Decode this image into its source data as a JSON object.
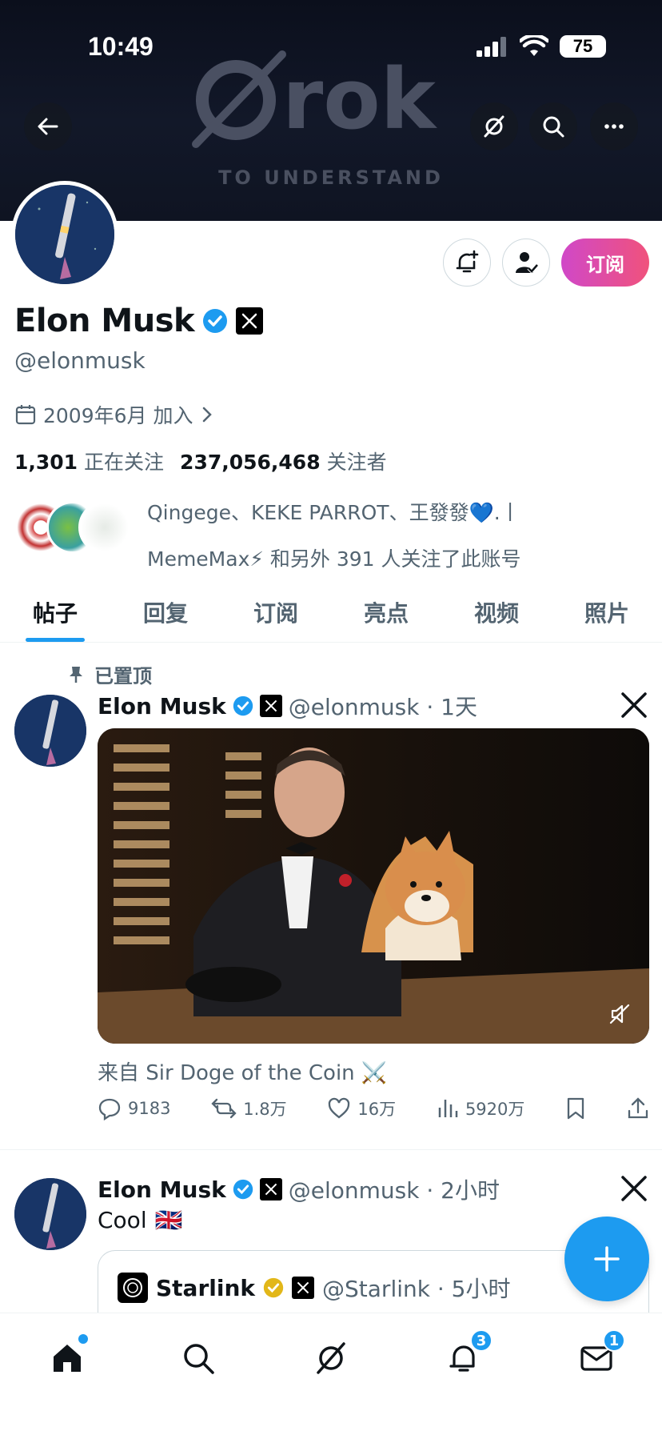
{
  "status_bar": {
    "time": "10:49",
    "battery": "75"
  },
  "banner": {
    "logo_text": "Grok",
    "tagline": "TO UNDERSTAND"
  },
  "profile": {
    "name": "Elon Musk",
    "handle": "@elonmusk",
    "joined": "2009年6月 加入",
    "following_count": "1,301",
    "following_label": "正在关注",
    "followers_count": "237,056,468",
    "followers_label": "关注者",
    "followed_by_line1": "Qingege、KEKE PARROT、王發發💙.丨",
    "followed_by_line2": "MemeMax⚡ 和另外 391 人关注了此账号",
    "subscribe_label": "订阅"
  },
  "tabs": [
    {
      "label": "帖子",
      "active": true
    },
    {
      "label": "回复"
    },
    {
      "label": "订阅"
    },
    {
      "label": "亮点"
    },
    {
      "label": "视频"
    },
    {
      "label": "照片"
    }
  ],
  "posts": [
    {
      "pinned_label": "已置顶",
      "name": "Elon Musk",
      "meta": "@elonmusk · 1天",
      "caption": "来自 Sir Doge of the Coin ⚔️",
      "replies": "9183",
      "reposts": "1.8万",
      "likes": "16万",
      "views": "5920万"
    },
    {
      "name": "Elon Musk",
      "meta": "@elonmusk · 2小时",
      "text": "Cool",
      "flag": "🇬🇧",
      "quote": {
        "name": "Starlink",
        "meta": "@Starlink · 5小时"
      }
    }
  ],
  "bottom_nav": {
    "notifications_badge": "3",
    "messages_badge": "1"
  },
  "colors": {
    "accent": "#1d9bf0",
    "subscribe_gradient_start": "#d048c8",
    "subscribe_gradient_end": "#f0527c",
    "gold_check": "#e2b719"
  }
}
